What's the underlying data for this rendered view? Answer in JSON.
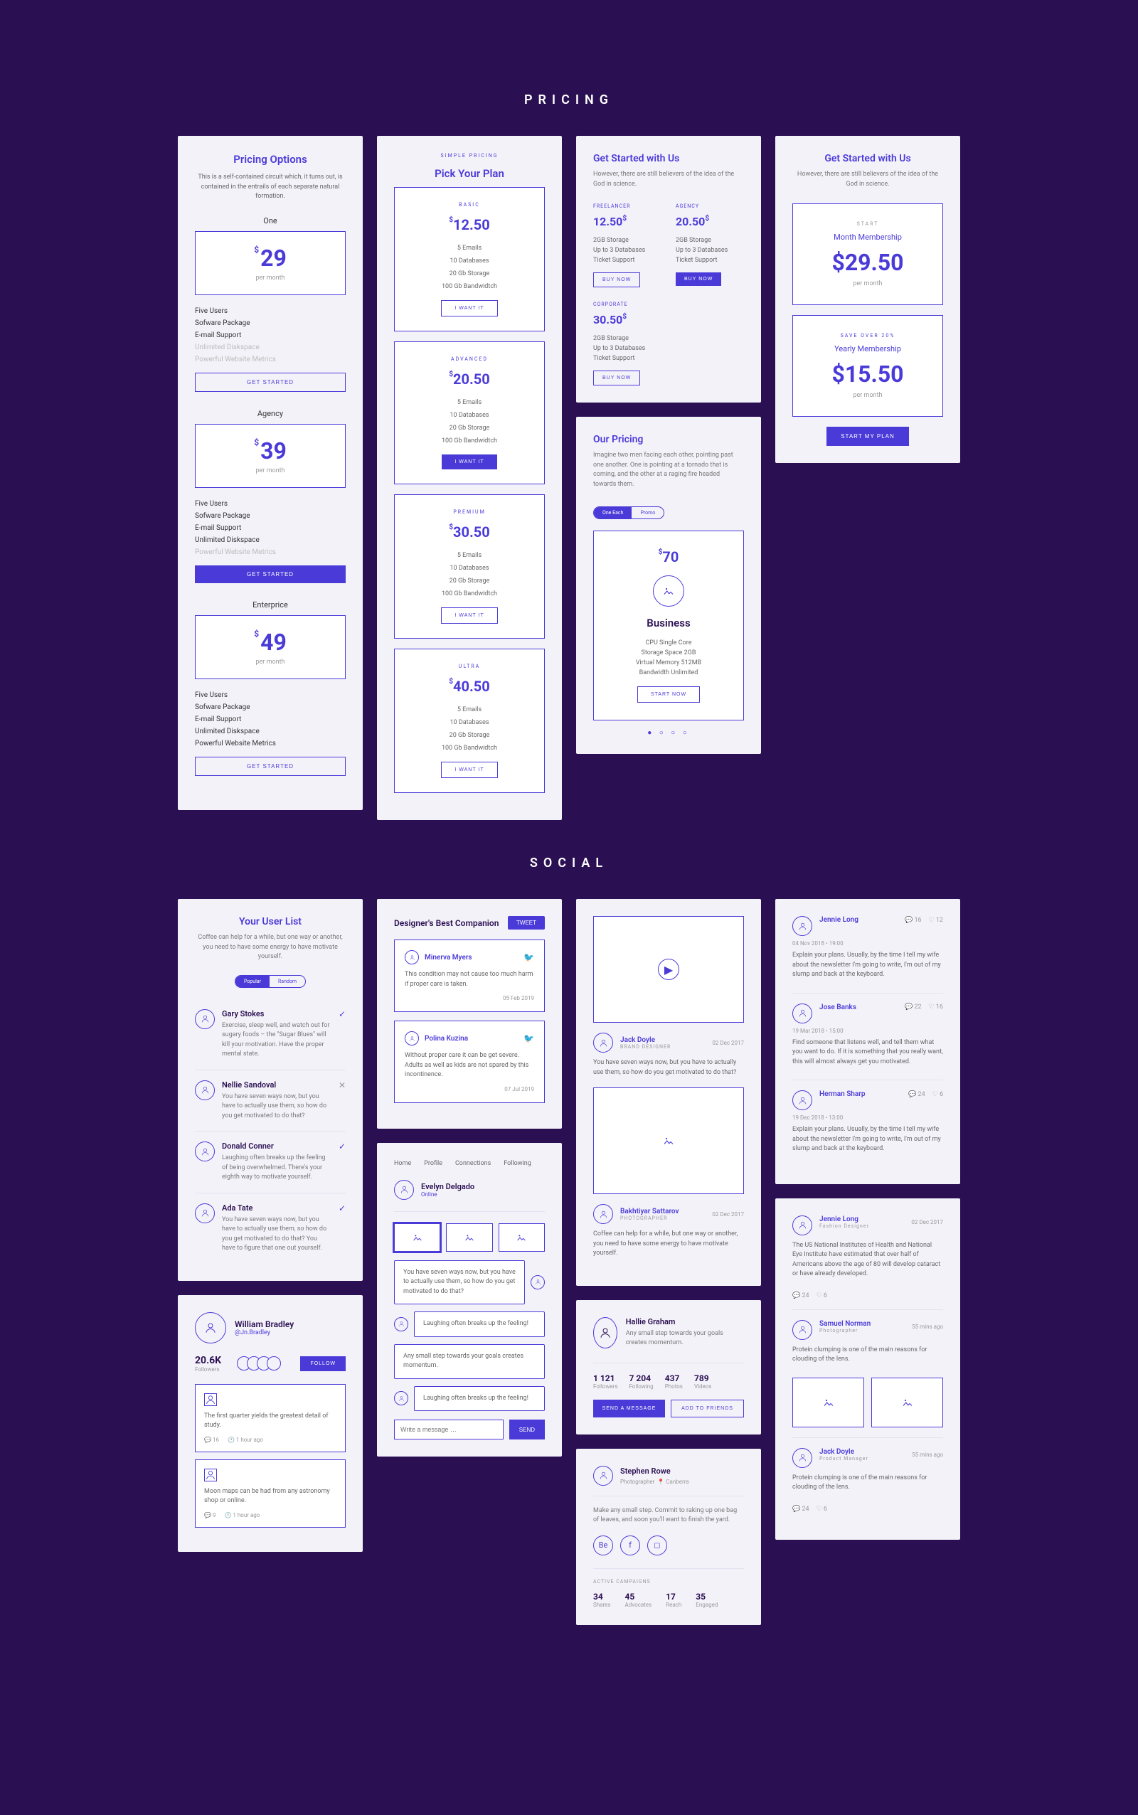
{
  "sections": {
    "pricing": "PRICING",
    "social": "SOCIAL"
  },
  "p1": {
    "title": "Pricing Options",
    "sub": "This is a self-contained circuit which, it turns out, is contained in the entrails of each separate natural formation.",
    "plans": [
      {
        "name": "One",
        "price": "29",
        "per": "per month",
        "feat": [
          "Five Users",
          "Sofware Package",
          "E-mail Support",
          "Unlimited Diskspace",
          "Powerful Website Metrics"
        ],
        "dim": [
          3,
          4
        ],
        "cta": "GET STARTED",
        "fill": false
      },
      {
        "name": "Agency",
        "price": "39",
        "per": "per month",
        "feat": [
          "Five Users",
          "Sofware Package",
          "E-mail Support",
          "Unlimited Diskspace",
          "Powerful Website Metrics"
        ],
        "dim": [
          4
        ],
        "cta": "GET STARTED",
        "fill": true
      },
      {
        "name": "Enterprice",
        "price": "49",
        "per": "per month",
        "feat": [
          "Five Users",
          "Sofware Package",
          "E-mail Support",
          "Unlimited Diskspace",
          "Powerful Website Metrics"
        ],
        "dim": [],
        "cta": "GET STARTED",
        "fill": false
      }
    ]
  },
  "p2": {
    "eyebrow": "SIMPLE PRICING",
    "title": "Pick Your Plan",
    "tiers": [
      {
        "label": "BASIC",
        "price": "12.50",
        "feat": [
          "5 Emails",
          "10 Databases",
          "20 Gb Storage",
          "100 Gb Bandwidtch"
        ],
        "cta": "I WANT IT",
        "fill": false
      },
      {
        "label": "ADVANCED",
        "price": "20.50",
        "feat": [
          "5 Emails",
          "10 Databases",
          "20 Gb Storage",
          "100 Gb Bandwidtch"
        ],
        "cta": "I WANT IT",
        "fill": true
      },
      {
        "label": "PREMIUM",
        "price": "30.50",
        "feat": [
          "5 Emails",
          "10 Databases",
          "20 Gb Storage",
          "100 Gb Bandwidtch"
        ],
        "cta": "I WANT IT",
        "fill": false
      },
      {
        "label": "ULTRA",
        "price": "40.50",
        "feat": [
          "5 Emails",
          "10 Databases",
          "20 Gb Storage",
          "100 Gb Bandwidtch"
        ],
        "cta": "I WANT IT",
        "fill": false
      }
    ]
  },
  "p3": {
    "title": "Get Started with Us",
    "sub": "However, there are still believers of the idea of the God in science.",
    "rowA": [
      {
        "label": "FREELANCER",
        "price": "12.50",
        "feat": [
          "2GB Storage",
          "Up to 3 Databases",
          "Ticket Support"
        ],
        "cta": "BUY NOW",
        "fill": false
      },
      {
        "label": "AGENCY",
        "price": "20.50",
        "feat": [
          "2GB Storage",
          "Up to 3 Databases",
          "Ticket Support"
        ],
        "cta": "BUY NOW",
        "fill": true
      }
    ],
    "corp": {
      "label": "CORPORATE",
      "price": "30.50",
      "feat": [
        "2GB Storage",
        "Up to 3 Databases",
        "Ticket Support"
      ],
      "cta": "BUY NOW"
    }
  },
  "p4": {
    "title": "Our Pricing",
    "sub": "Imagine two men facing each other, pointing past one another. One is pointing at a tornado that is coming, and the other at a raging fire headed towards them.",
    "toggle": [
      "One Each",
      "Promo"
    ],
    "price": "70",
    "name": "Business",
    "feat": [
      "CPU Single Core",
      "Storage Space 2GB",
      "Virtual Memory 512MB",
      "Bandwidth Unlimited"
    ],
    "cta": "START NOW"
  },
  "p5": {
    "title": "Get Started with Us",
    "sub": "However, there are still believers of the idea of the God in science.",
    "plans": [
      {
        "tag": "START",
        "name": "Month Membership",
        "price": "$29.50",
        "per": "per month"
      },
      {
        "tag": "SAVE OVER 20%",
        "name": "Yearly Membership",
        "price": "$15.50",
        "per": "per month"
      }
    ],
    "cta": "START MY PLAN"
  },
  "s1": {
    "title": "Your User List",
    "sub": "Coffee can help for a while, but one way or another, you need to have some energy to have motivate yourself.",
    "toggle": [
      "Popular",
      "Random"
    ],
    "users": [
      {
        "name": "Gary Stokes",
        "text": "Exercise, sleep well, and watch out for sugary foods – the \"Sugar Blues\" will kill your motivation. Have the proper mental state.",
        "ok": true
      },
      {
        "name": "Nellie Sandoval",
        "text": "You have seven ways now, but you have to actually use them, so how do you get motivated to do that?",
        "ok": false
      },
      {
        "name": "Donald Conner",
        "text": "Laughing often breaks up the feeling of being overwhelmed. There's your eighth way to motivate yourself.",
        "ok": true
      },
      {
        "name": "Ada Tate",
        "text": "You have seven ways now, but you have to actually use them, so how do you get motivated to do that? You have to figure that one out yourself.",
        "ok": true
      }
    ]
  },
  "s2": {
    "name": "William Bradley",
    "handle": "@Jn.Bradley",
    "count": "20.6K",
    "count_l": "Followers",
    "follow": "FOLLOW",
    "notes": [
      {
        "text": "The first quarter yields the greatest detail of study.",
        "c": "16",
        "t": "1 hour ago"
      },
      {
        "text": "Moon maps can be had from any astronomy shop or online.",
        "c": "9",
        "t": "1 hour ago"
      }
    ]
  },
  "s3": {
    "title": "Designer's Best Companion",
    "btn": "TWEET",
    "tweets": [
      {
        "name": "Minerva Myers",
        "text": "This condition may not cause too much harm if proper care is taken.",
        "date": "05 Feb 2019"
      },
      {
        "name": "Polina Kuzina",
        "text": "Without proper care it can be get severe. Adults as well as kids are not spared by this incontinence.",
        "date": "07 Jul 2019"
      }
    ]
  },
  "s4": {
    "tabs": [
      "Home",
      "Profile",
      "Connections",
      "Following"
    ],
    "name": "Evelyn Delgado",
    "status": "Online",
    "msgs": [
      "You have seven ways now, but you have to actually use them, so how do you get motivated to do that?",
      "Laughing often breaks up the feeling!",
      "Any small step towards your goals creates momentum.",
      "Laughing often breaks up the feeling!"
    ],
    "placeholder": "Write a message …",
    "send": "SEND"
  },
  "s5": {
    "posts": [
      {
        "name": "Jack Doyle",
        "role": "BRAND DESIGNER",
        "date": "02 Dec 2017",
        "text": "You have seven ways now, but you have to actually use them, so how do you get motivated to do that?",
        "media": "video"
      },
      {
        "name": "Bakhtiyar Sattarov",
        "role": "PHOTOGRAPHER",
        "date": "02 Dec 2017",
        "text": "Coffee can help for a while, but one way or another, you need to have some energy to have motivate yourself.",
        "media": "image"
      }
    ]
  },
  "s6": {
    "name": "Hallie Graham",
    "bio": "Any small step towards your goals creates momentum.",
    "stats": [
      [
        "1 121",
        "Followers"
      ],
      [
        "7 204",
        "Following"
      ],
      [
        "437",
        "Photos"
      ],
      [
        "789",
        "Videos"
      ]
    ],
    "btns": [
      "SEND A MESSAGE",
      "ADD TO FRIENDS"
    ]
  },
  "s7": {
    "name": "Stephen Rowe",
    "role": "Photographer",
    "loc": "Canberra",
    "text": "Make any small step. Commit to raking up one bag of leaves, and soon you'll want to finish the yard.",
    "label": "ACTIVE CAMPAIGNS",
    "stats": [
      [
        "34",
        "Shares"
      ],
      [
        "45",
        "Advocates"
      ],
      [
        "17",
        "Reach"
      ],
      [
        "35",
        "Engaged"
      ]
    ]
  },
  "s8": {
    "items": [
      {
        "name": "Jennie Long",
        "date": "04 Nov 2018 • 19:00",
        "text": "Explain your plans. Usually, by the time I tell my wife about the newsletter I'm going to write, I'm out of my slump and back at the keyboard.",
        "c": "16",
        "l": "12"
      },
      {
        "name": "Jose Banks",
        "date": "19 Mar 2018 • 15:00",
        "text": "Find someone that listens well, and tell them what you want to do. If it is something that you really want, this will almost always get you motivated.",
        "c": "22",
        "l": "16"
      },
      {
        "name": "Herman Sharp",
        "date": "19 Dec 2018 • 13:00",
        "text": "Explain your plans. Usually, by the time I tell my wife about the newsletter I'm going to write, I'm out of my slump and back at the keyboard.",
        "c": "24",
        "l": "6"
      }
    ]
  },
  "s9": {
    "items": [
      {
        "name": "Jennie Long",
        "role": "Fashion Designer",
        "date": "02 Dec 2017",
        "text": "The US National Institutes of Health and National Eye Institute have estimated that over half of Americans above the age of 80 will develop cataract or have already developed.",
        "c": "24",
        "l": "6",
        "imgs": false
      },
      {
        "name": "Samuel Norman",
        "role": "Photographer",
        "date": "55 mins ago",
        "text": "Protein clumping is one of the main reasons for clouding of the lens.",
        "imgs": true
      },
      {
        "name": "Jack Doyle",
        "role": "Product Manager",
        "date": "55 mins ago",
        "text": "Protein clumping is one of the main reasons for clouding of the lens.",
        "c": "24",
        "l": "6",
        "imgs": false
      }
    ]
  }
}
